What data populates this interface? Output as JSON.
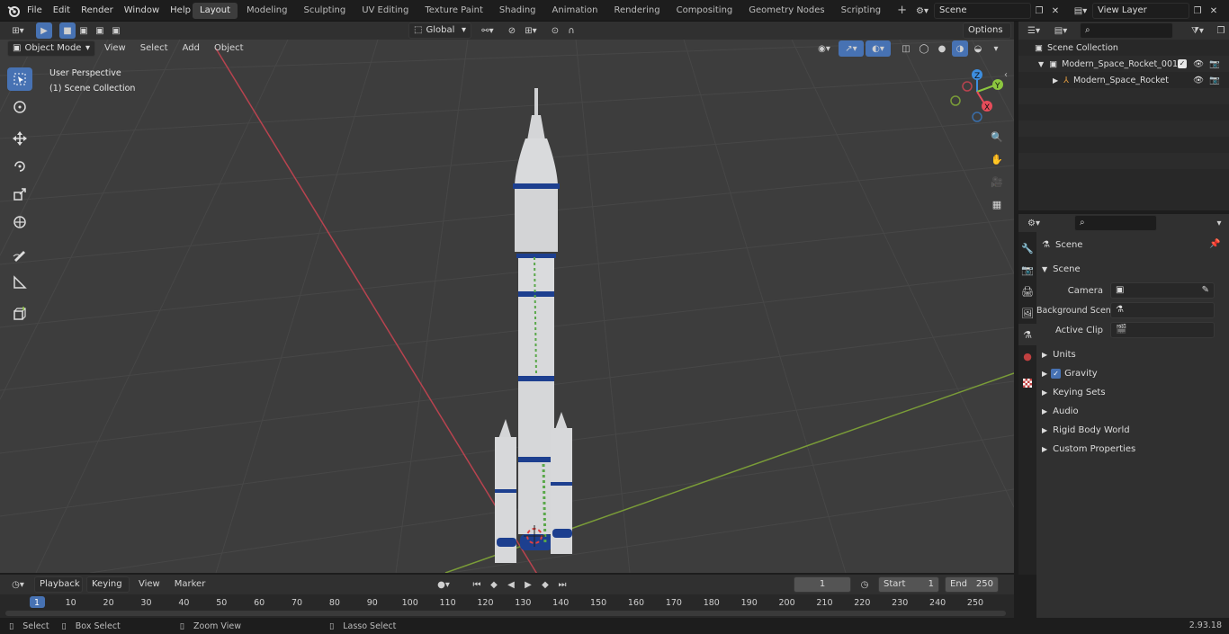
{
  "topbar": {
    "menus": [
      "File",
      "Edit",
      "Render",
      "Window",
      "Help"
    ],
    "workspaces": [
      "Layout",
      "Modeling",
      "Sculpting",
      "UV Editing",
      "Texture Paint",
      "Shading",
      "Animation",
      "Rendering",
      "Compositing",
      "Geometry Nodes",
      "Scripting"
    ],
    "active_workspace": "Layout",
    "add_tab": "+",
    "scene_name": "Scene",
    "view_layer": "View Layer"
  },
  "viewport_header": {
    "mode": "Object Mode",
    "menus": [
      "View",
      "Select",
      "Add",
      "Object"
    ],
    "transform_orientation": "Global",
    "options": "Options"
  },
  "viewport": {
    "perspective": "User Perspective",
    "collection": "(1) Scene Collection",
    "gizmo_axes": {
      "z": "Z",
      "y": "Y",
      "x": "X"
    }
  },
  "outliner": {
    "root": "Scene Collection",
    "items": [
      {
        "label": "Modern_Space_Rocket_001"
      },
      {
        "label": "Modern_Space_Rocket"
      }
    ]
  },
  "properties": {
    "context": "Scene",
    "panel": "Scene",
    "fields": [
      {
        "label": "Camera",
        "value": ""
      },
      {
        "label": "Background Scene",
        "value": ""
      },
      {
        "label": "Active Clip",
        "value": ""
      }
    ],
    "sections": [
      "Units",
      "Gravity",
      "Keying Sets",
      "Audio",
      "Rigid Body World",
      "Custom Properties"
    ],
    "gravity_enabled": true
  },
  "timeline": {
    "menus": [
      "Playback",
      "Keying",
      "View",
      "Marker"
    ],
    "current_frame": "1",
    "start_label": "Start",
    "start": "1",
    "end_label": "End",
    "end": "250",
    "ticks": [
      "1",
      "10",
      "20",
      "30",
      "40",
      "50",
      "60",
      "70",
      "80",
      "90",
      "100",
      "110",
      "120",
      "130",
      "140",
      "150",
      "160",
      "170",
      "180",
      "190",
      "200",
      "210",
      "220",
      "230",
      "240",
      "250"
    ]
  },
  "statusbar": {
    "select": "Select",
    "box_select": "Box Select",
    "zoom_view": "Zoom View",
    "lasso_select": "Lasso Select",
    "version": "2.93.18"
  },
  "colors": {
    "accent": "#4772b3",
    "x_axis": "#e74c5a",
    "y_axis": "#8cc63f",
    "z_axis": "#3d8ee0",
    "rocket_stripe": "#1d3f8f",
    "rocket_body": "#d9dadc"
  }
}
